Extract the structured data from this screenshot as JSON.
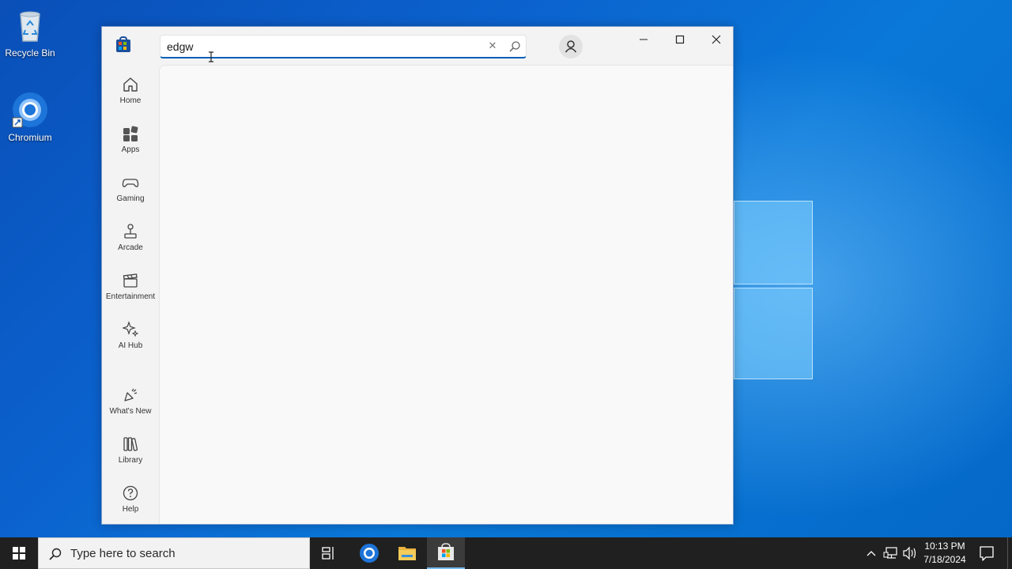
{
  "desktop": {
    "icons": [
      {
        "label": "Recycle Bin",
        "icon": "recycle-bin-icon"
      },
      {
        "label": "Chromium",
        "icon": "chromium-icon"
      }
    ]
  },
  "store": {
    "search": {
      "value": "edgw",
      "placeholder": ""
    },
    "nav": [
      {
        "label": "Home",
        "icon": "home-icon"
      },
      {
        "label": "Apps",
        "icon": "apps-icon"
      },
      {
        "label": "Gaming",
        "icon": "gamepad-icon"
      },
      {
        "label": "Arcade",
        "icon": "joystick-icon"
      },
      {
        "label": "Entertainment",
        "icon": "clapperboard-icon"
      },
      {
        "label": "AI Hub",
        "icon": "sparkle-icon"
      },
      {
        "label": "What's New",
        "icon": "megaphone-icon"
      },
      {
        "label": "Library",
        "icon": "library-icon"
      },
      {
        "label": "Help",
        "icon": "help-icon"
      }
    ]
  },
  "taskbar": {
    "search_placeholder": "Type here to search",
    "time": "10:13 PM",
    "date": "7/18/2024",
    "accent": "#76b9ed"
  }
}
